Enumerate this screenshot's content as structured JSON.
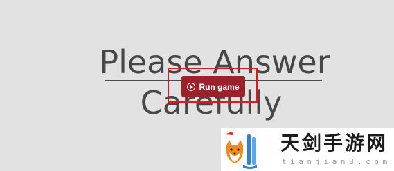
{
  "game": {
    "title_line1": "Please Answer",
    "title_line2": "Carefully",
    "run_button_label": "Run game",
    "button_color": "#9b222a",
    "highlight_color": "#e0181e",
    "background_color": "#e2e2e2"
  },
  "watermark": {
    "brand_text": "天剑手游网",
    "url_text": "tianjianB.com"
  }
}
